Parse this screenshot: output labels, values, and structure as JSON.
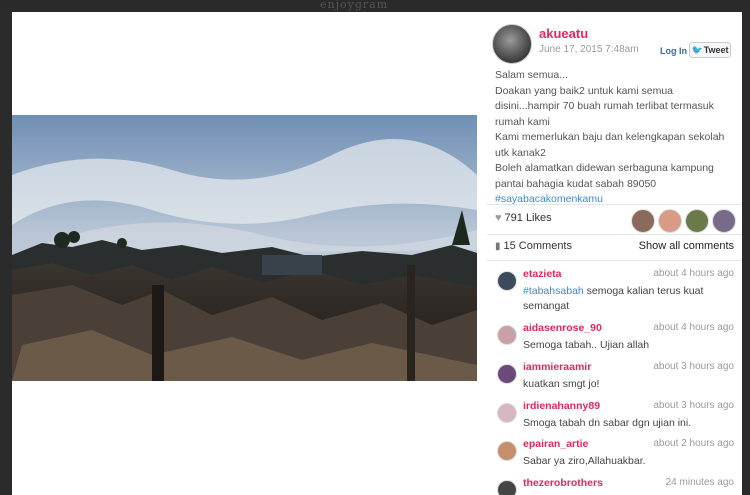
{
  "site": {
    "brand": "enjoygram"
  },
  "post": {
    "username": "akueatu",
    "date": "June 17, 2015 7:48am",
    "login_label": "Log In",
    "tweet_label": "Tweet",
    "caption_lines": [
      "Salam semua...",
      "Doakan yang baik2 untuk kami semua disini...hampir 70 buah rumah terlibat termasuk rumah kami",
      "Kami memerlukan baju dan kelengkapan sekolah utk kanak2",
      "Boleh alamatkan didewan serbaguna kampung pantai bahagia kudat sabah 89050"
    ],
    "hashtag": "#sayabacakomenkamu",
    "likes": "791 Likes",
    "comments_count": "15 Comments",
    "show_all": "Show all comments"
  },
  "comments": [
    {
      "user": "etazieta",
      "time": "about 4 hours ago",
      "tag": "#tabahsabah",
      "text": " semoga kalian terus kuat semangat",
      "avatar_color": "#3c4a5a"
    },
    {
      "user": "aidasenrose_90",
      "time": "about 4 hours ago",
      "tag": "",
      "text": "Semoga tabah.. Ujian allah",
      "avatar_color": "#c9a0a8"
    },
    {
      "user": "iammieraamir",
      "time": "about 3 hours ago",
      "tag": "",
      "text": "kuatkan smgt jo!",
      "avatar_color": "#6b4a7a"
    },
    {
      "user": "irdienahanny89",
      "time": "about 3 hours ago",
      "tag": "",
      "text": "Smoga tabah dn sabar dgn ujian ini.",
      "avatar_color": "#d6b8c2"
    },
    {
      "user": "epairan_artie",
      "time": "about 2 hours ago",
      "tag": "",
      "text": "Sabar ya ziro,Allahuakbar.",
      "avatar_color": "#c48f6a"
    },
    {
      "user": "thezerobrothers",
      "time": "24 minutes ago",
      "tag": "",
      "text": "",
      "avatar_color": "#444444"
    }
  ],
  "likers": [
    {
      "color": "#8a6a5a"
    },
    {
      "color": "#d99a86"
    },
    {
      "color": "#6a7a4a"
    },
    {
      "color": "#7a6a8a"
    }
  ]
}
